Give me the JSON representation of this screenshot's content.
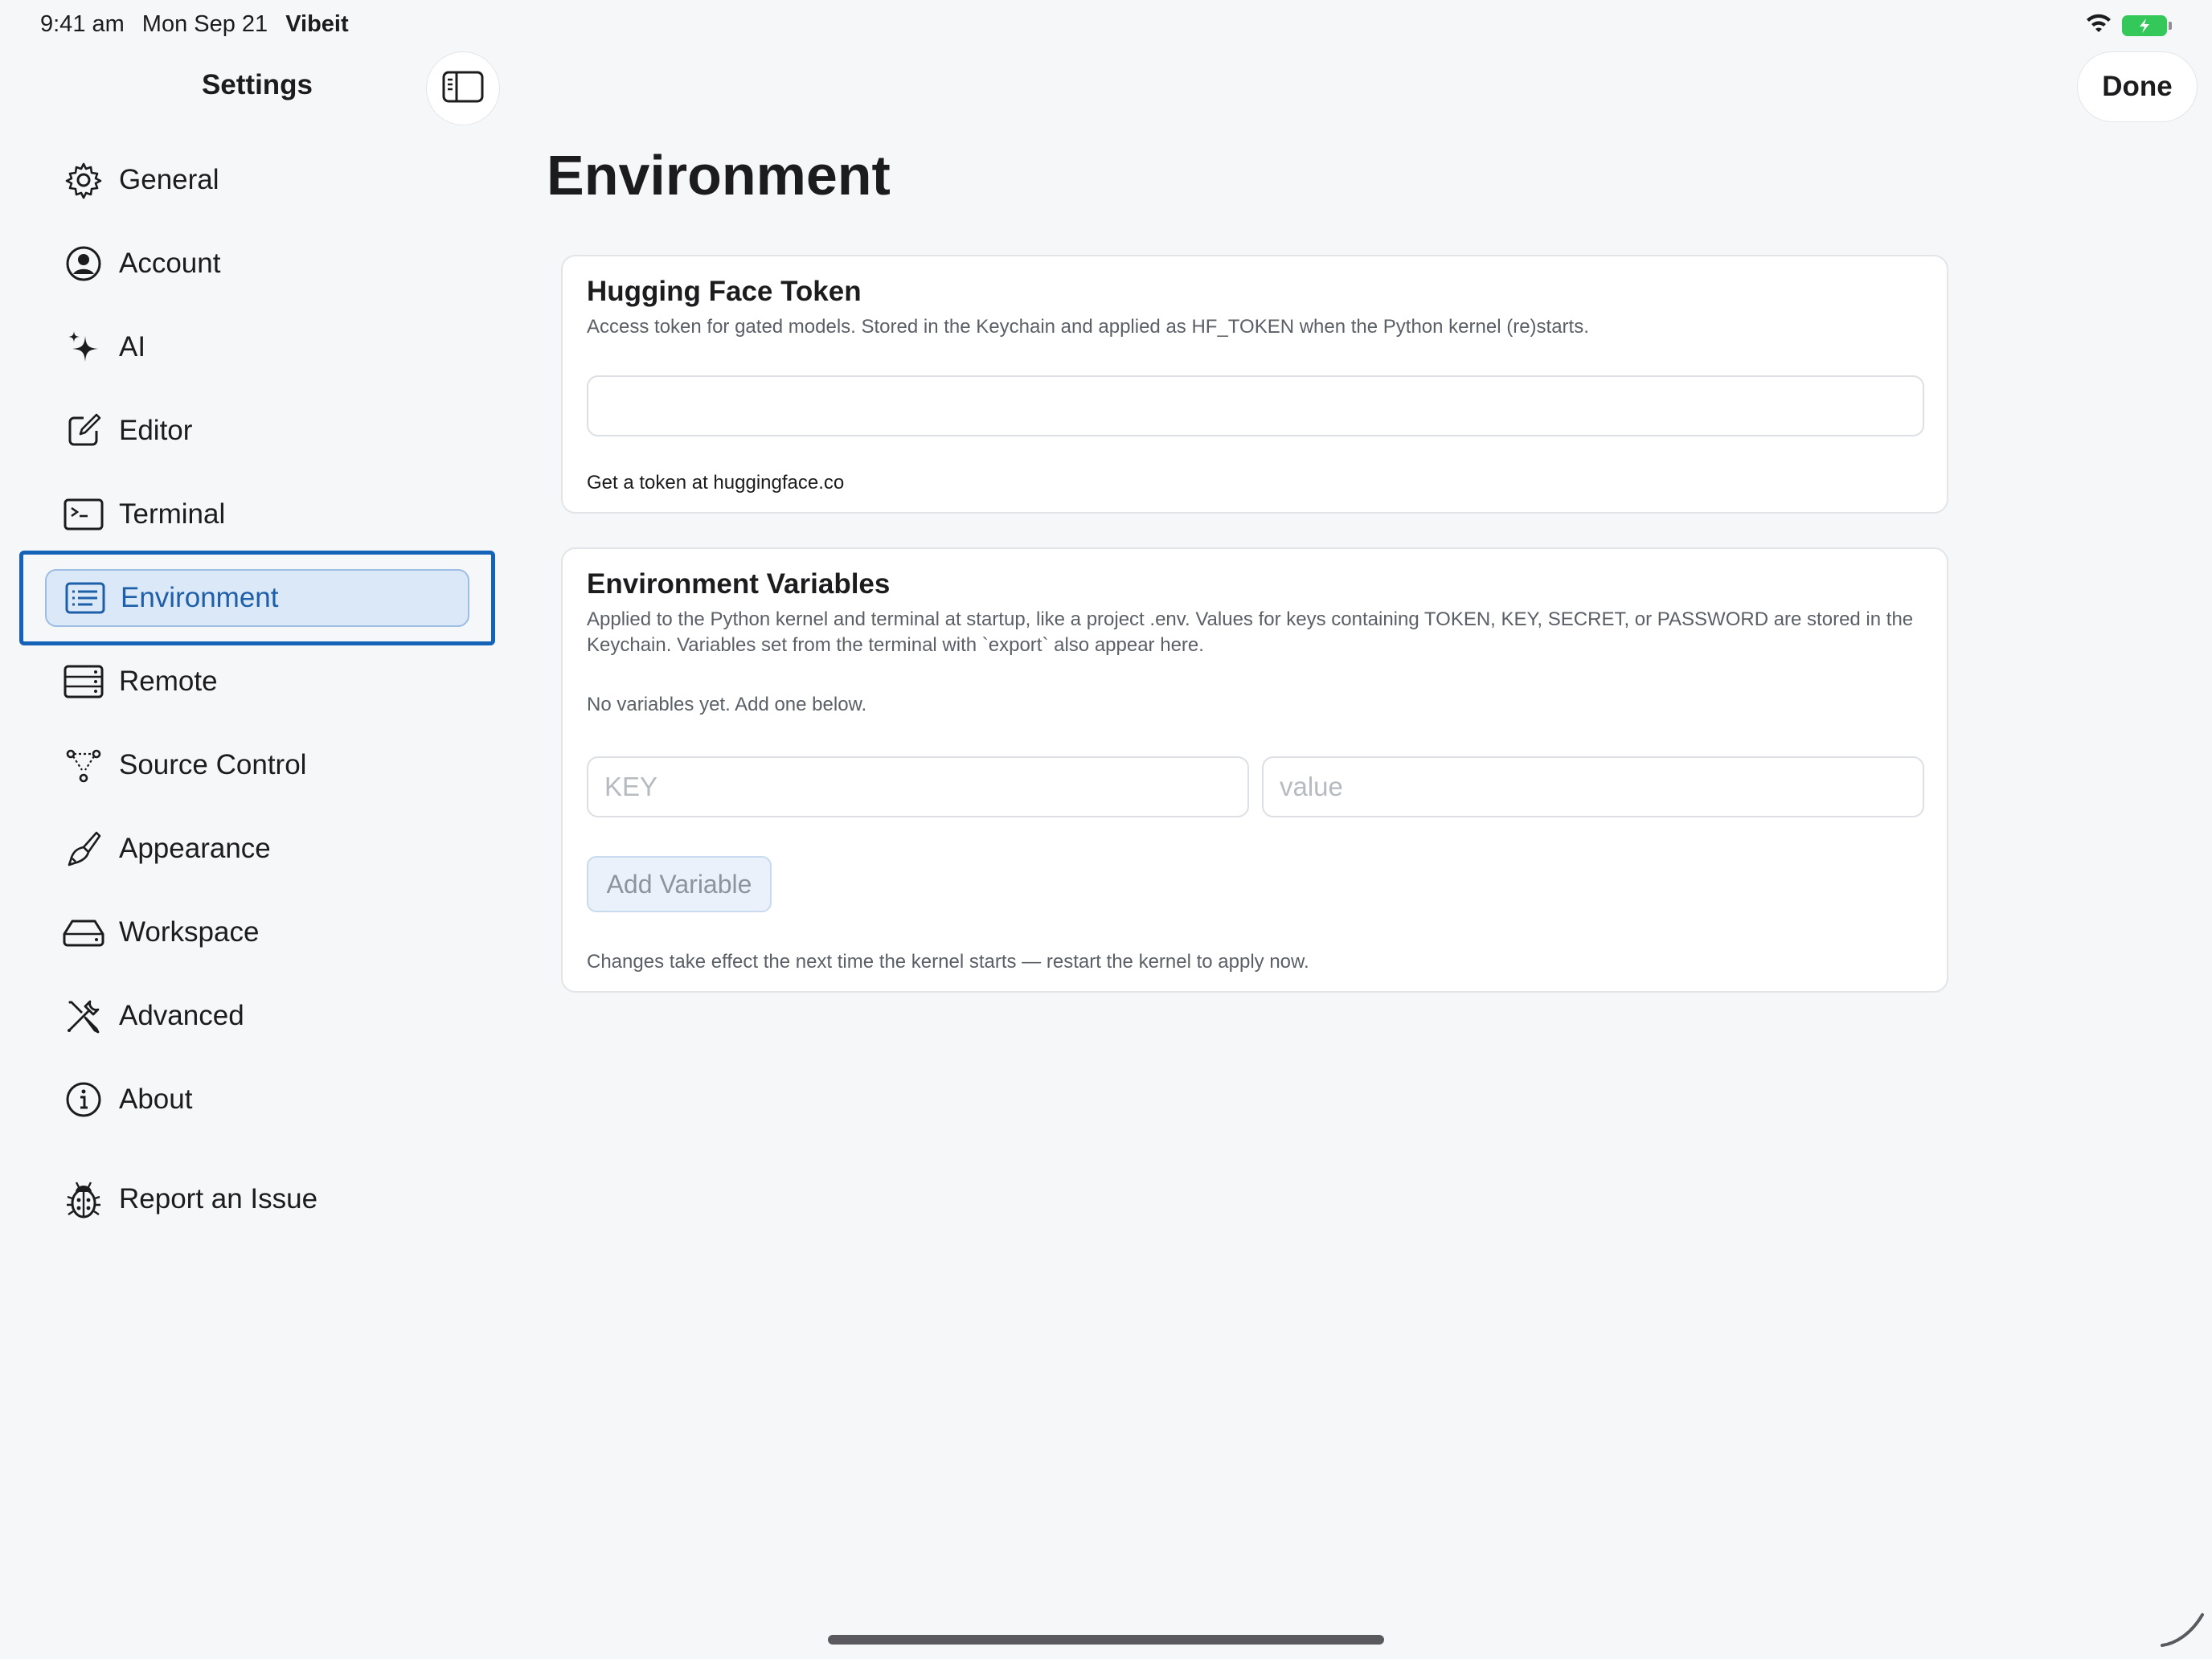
{
  "status_bar": {
    "time": "9:41 am",
    "date": "Mon Sep 21",
    "app": "Vibeit"
  },
  "sidebar": {
    "title": "Settings",
    "items": [
      {
        "label": "General",
        "icon": "gear-icon"
      },
      {
        "label": "Account",
        "icon": "person-circle-icon"
      },
      {
        "label": "AI",
        "icon": "sparkles-icon"
      },
      {
        "label": "Editor",
        "icon": "square-pencil-icon"
      },
      {
        "label": "Terminal",
        "icon": "terminal-icon"
      },
      {
        "label": "Environment",
        "icon": "list-rectangle-icon",
        "selected": true
      },
      {
        "label": "Remote",
        "icon": "server-rack-icon"
      },
      {
        "label": "Source Control",
        "icon": "branch-icon"
      },
      {
        "label": "Appearance",
        "icon": "paintbrush-icon"
      },
      {
        "label": "Workspace",
        "icon": "drive-icon"
      },
      {
        "label": "Advanced",
        "icon": "wrench-screwdriver-icon"
      },
      {
        "label": "About",
        "icon": "info-circle-icon"
      },
      {
        "label": "Report an Issue",
        "icon": "ladybug-icon"
      }
    ]
  },
  "header": {
    "done_label": "Done"
  },
  "main": {
    "title": "Environment",
    "hf_card": {
      "title": "Hugging Face Token",
      "description": "Access token for gated models. Stored in the Keychain and applied as HF_TOKEN when the Python kernel (re)starts.",
      "token_value": "",
      "footer": "Get a token at huggingface.co"
    },
    "env_card": {
      "title": "Environment Variables",
      "description": "Applied to the Python kernel and terminal at startup, like a project .env. Values for keys containing TOKEN, KEY, SECRET, or PASSWORD are stored in the Keychain. Variables set from the terminal with `export` also appear here.",
      "empty_text": "No variables yet. Add one below.",
      "key_placeholder": "KEY",
      "value_placeholder": "value",
      "add_label": "Add Variable",
      "footer": "Changes take effect the next time the kernel starts — restart the kernel to apply now."
    }
  },
  "colors": {
    "accent": "#1463b8",
    "selected_bg": "#dbe8f8",
    "battery": "#34c759"
  }
}
